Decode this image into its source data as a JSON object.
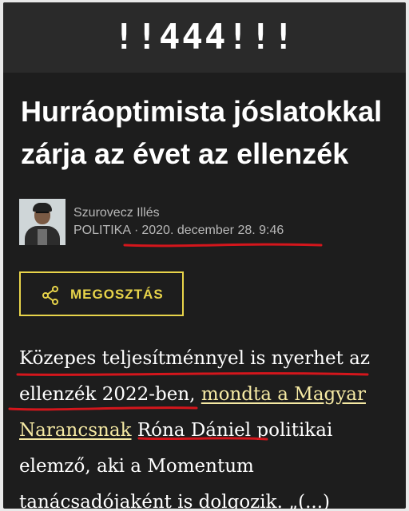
{
  "header": {
    "logo": "!!444!!!"
  },
  "article": {
    "title": "Hurráoptimista jóslatokkal zárja az évet az ellenzék",
    "author": "Szurovecz Illés",
    "category": "POLITIKA",
    "separator": "·",
    "date": "2020. december 28. 9:46",
    "share_label": "MEGOSZTÁS",
    "body": {
      "line1": "Közepes teljesítménnyel is nyerhet az",
      "line2_prefix": "ellenzék 2022-ben, ",
      "line2_link": "mondta a Magyar",
      "line3_link": "Narancsnak",
      "line3_suffix": " Róna Dániel politikai",
      "line4": "elemző, aki a Momentum",
      "line5": "tanácsadójaként is dolgozik. „(...)"
    }
  },
  "colors": {
    "background": "#1d1d1d",
    "header": "#2a2a2a",
    "accent": "#e8d44a",
    "link": "#f6eaa4",
    "annotation": "#d4161c"
  },
  "icons": {
    "share": "share-icon"
  }
}
